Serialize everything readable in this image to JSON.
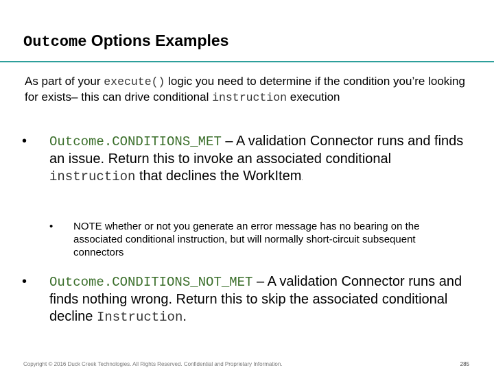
{
  "title": {
    "code": "Outcome",
    "text": " Options Examples"
  },
  "intro": {
    "t1": "As part of your ",
    "code1": "execute()",
    "t2": " logic you need to determine if the condition you’re looking for exists– this can drive conditional ",
    "code2": "instruction",
    "t3": " execution"
  },
  "bullet1": {
    "marker": "•",
    "code": "Outcome.CONDITIONS_MET",
    "t1": " – A validation Connector runs and finds an issue. Return this to invoke an associated conditional ",
    "code2": "instruction",
    "t2": " that declines the WorkItem",
    "t3": "."
  },
  "sub1": {
    "marker": "•",
    "text": "NOTE whether or not you generate an error message has no bearing on the associated conditional instruction, but will normally short-circuit subsequent connectors"
  },
  "bullet2": {
    "marker": "•",
    "code": "Outcome.CONDITIONS_NOT_MET",
    "t1": "  – A validation Connector runs and finds nothing wrong. Return this to skip the associated conditional decline ",
    "code2": "Instruction",
    "t2": "."
  },
  "footer": {
    "text": "Copyright © 2016 Duck Creek Technologies. All Rights Reserved. Confidential and Proprietary Information.",
    "page": "285"
  },
  "colors": {
    "accent_rule": "#2e9f9b",
    "code_green": "#3a6e2a"
  }
}
